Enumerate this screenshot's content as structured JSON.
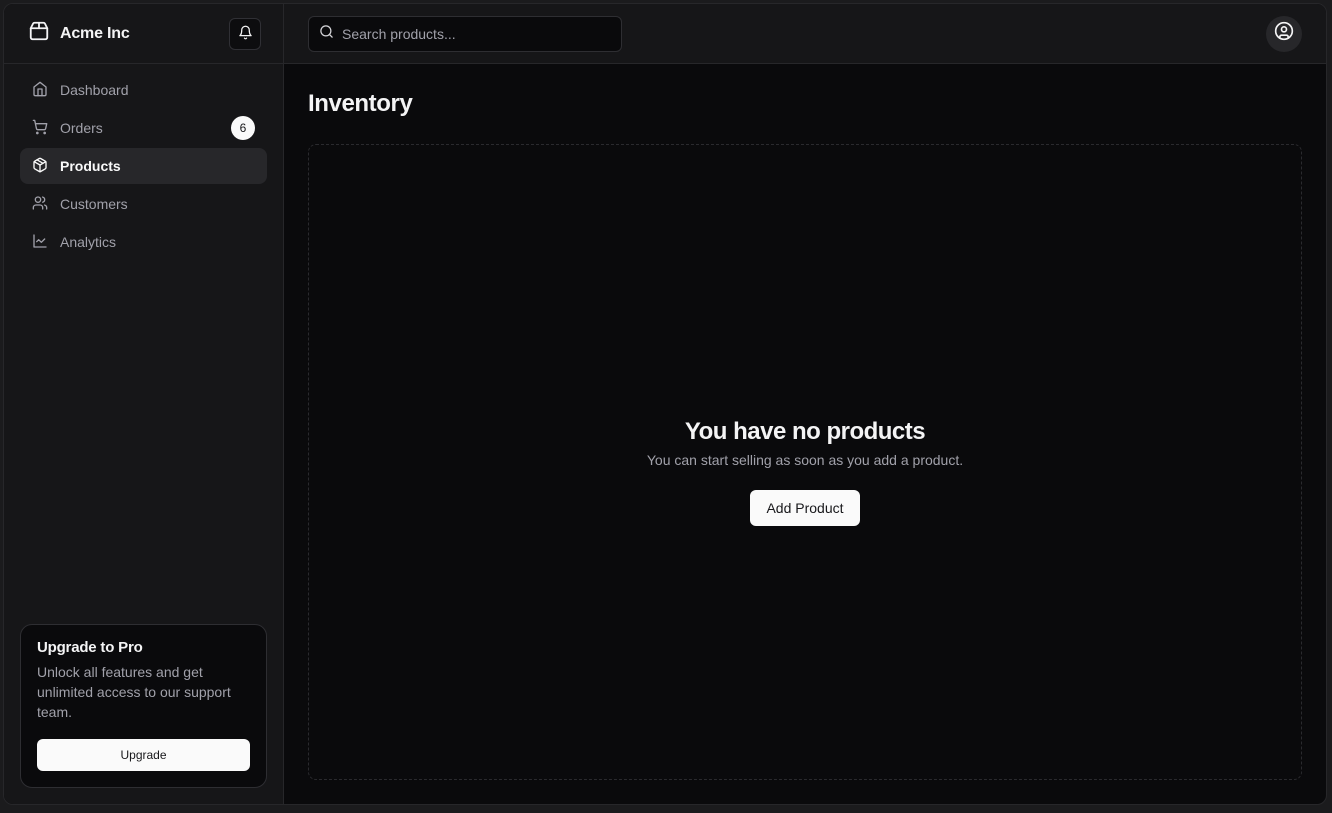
{
  "brand": {
    "name": "Acme Inc",
    "icon": "package-icon"
  },
  "notifications": {
    "icon": "bell-icon"
  },
  "sidebar": {
    "items": [
      {
        "label": "Dashboard",
        "icon": "home-icon",
        "active": false
      },
      {
        "label": "Orders",
        "icon": "cart-icon",
        "active": false,
        "badge": "6"
      },
      {
        "label": "Products",
        "icon": "box-icon",
        "active": true
      },
      {
        "label": "Customers",
        "icon": "users-icon",
        "active": false
      },
      {
        "label": "Analytics",
        "icon": "line-chart-icon",
        "active": false
      }
    ]
  },
  "upgrade": {
    "title": "Upgrade to Pro",
    "text": "Unlock all features and get unlimited access to our support team.",
    "button": "Upgrade"
  },
  "search": {
    "placeholder": "Search products...",
    "value": ""
  },
  "user": {
    "icon": "user-circle-icon"
  },
  "main": {
    "title": "Inventory",
    "empty_title": "You have no products",
    "empty_text": "You can start selling as soon as you add a product.",
    "add_button": "Add Product"
  },
  "colors": {
    "background": "#0a0a0c",
    "panel": "#161618",
    "border": "#27272a",
    "active": "#27272a",
    "text": "#fafafa",
    "muted": "#a1a1aa"
  }
}
